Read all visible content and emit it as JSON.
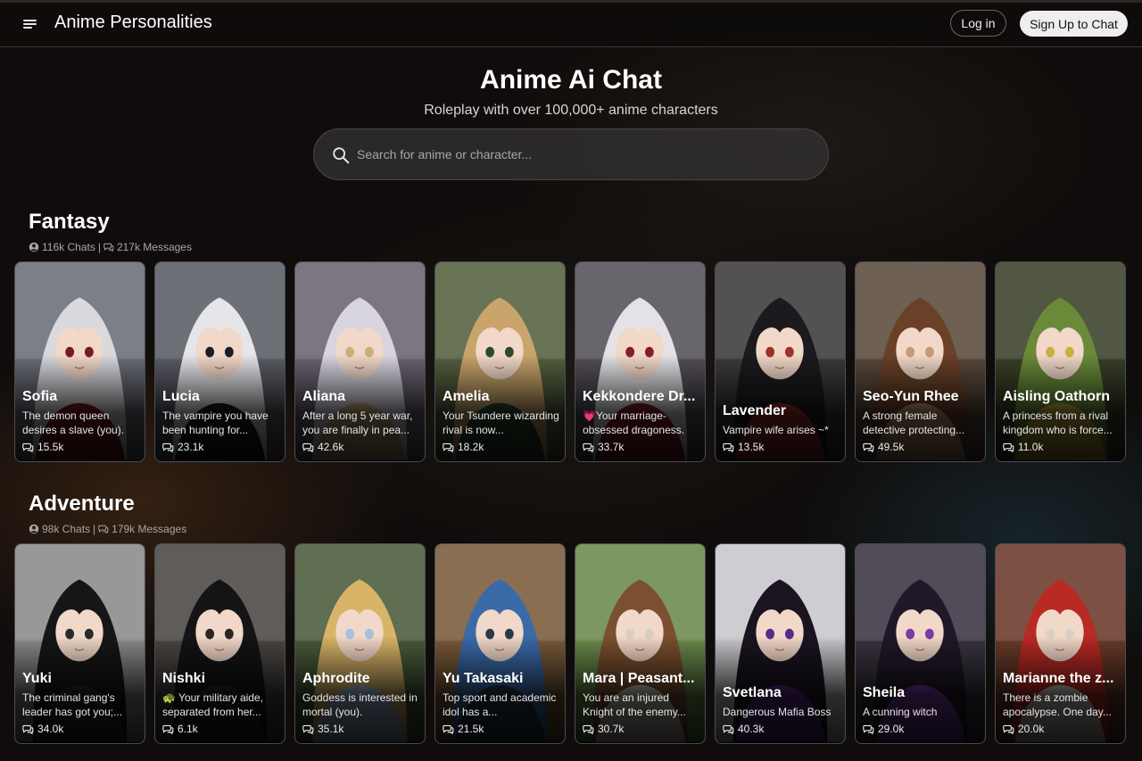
{
  "header": {
    "app_title": "Anime Personalities",
    "login_label": "Log in",
    "signup_label": "Sign Up to Chat"
  },
  "hero": {
    "title": "Anime Ai Chat",
    "subtitle": "Roleplay with over 100,000+ anime characters",
    "search_placeholder": "Search for anime or character..."
  },
  "sections": [
    {
      "title": "Fantasy",
      "chats": "116k Chats",
      "separator": "|",
      "messages": "217k Messages",
      "cards": [
        {
          "name": "Sofia",
          "desc": "The demon queen desires a slave (you).",
          "count": "15.5k",
          "hair": "#d9d9de",
          "bg": "#6b6e78",
          "accent": "#7a1a1a"
        },
        {
          "name": "Lucia",
          "desc": "The vampire you have been hunting for...",
          "count": "23.1k",
          "hair": "#e6e6ea",
          "bg": "#5b5d66",
          "accent": "#1c1c22"
        },
        {
          "name": "Aliana",
          "desc": "After a long 5 year war, you are finally in pea...",
          "count": "42.6k",
          "hair": "#d8d4e0",
          "bg": "#6a6470",
          "accent": "#c9b07a"
        },
        {
          "name": "Amelia",
          "desc": "Your Tsundere wizarding rival is now...",
          "count": "18.2k",
          "hair": "#c9a56c",
          "bg": "#55603f",
          "accent": "#2d4a2f"
        },
        {
          "name": "Kekkondere Dr...",
          "desc": "💗Your marriage-obsessed dragoness.",
          "count": "33.7k",
          "hair": "#e4e2e6",
          "bg": "#555058",
          "accent": "#8a1d22"
        },
        {
          "name": "Lavender",
          "desc": "Vampire wife arises ~*",
          "count": "13.5k",
          "hair": "#1c1a1e",
          "bg": "#3c3a3a",
          "accent": "#a0302a"
        },
        {
          "name": "Seo-Yun Rhee",
          "desc": "A strong female detective protecting...",
          "count": "49.5k",
          "hair": "#6a4128",
          "bg": "#5a4a3c",
          "accent": "#c89a76"
        },
        {
          "name": "Aisling Oathorn",
          "desc": "A princess from a rival kingdom who is force...",
          "count": "11.0k",
          "hair": "#6a8a3a",
          "bg": "#3a4028",
          "accent": "#c8b040"
        }
      ]
    },
    {
      "title": "Adventure",
      "chats": "98k Chats",
      "separator": "|",
      "messages": "179k Messages",
      "cards": [
        {
          "name": "Yuki",
          "desc": "The criminal gang's leader has got you;...",
          "count": "34.0k",
          "hair": "#161618",
          "bg": "#8a8a88",
          "accent": "#2a2a2c"
        },
        {
          "name": "Nishki",
          "desc": "🐢 Your military aide, separated from her...",
          "count": "6.1k",
          "hair": "#141416",
          "bg": "#4a4642",
          "accent": "#2a2624"
        },
        {
          "name": "Aphrodite",
          "desc": "Goddess is interested in mortal (you).",
          "count": "35.1k",
          "hair": "#d8b468",
          "bg": "#4a5a3a",
          "accent": "#a8c0e0"
        },
        {
          "name": "Yu Takasaki",
          "desc": "Top sport and academic idol has a...",
          "count": "21.5k",
          "hair": "#3a6aa8",
          "bg": "#7a5a3a",
          "accent": "#2a3a4a"
        },
        {
          "name": "Mara | Peasant...",
          "desc": "You are an injured Knight of the enemy...",
          "count": "30.7k",
          "hair": "#7a5030",
          "bg": "#6a8a4a",
          "accent": "#d8cfc0"
        },
        {
          "name": "Svetlana",
          "desc": "Dangerous Mafia Boss",
          "count": "40.3k",
          "hair": "#1a1420",
          "bg": "#c8c8cc",
          "accent": "#5a2a8a"
        },
        {
          "name": "Sheila",
          "desc": "A cunning witch",
          "count": "29.0k",
          "hair": "#201828",
          "bg": "#3a3440",
          "accent": "#7a3aa8"
        },
        {
          "name": "Marianne the z...",
          "desc": "There is a zombie apocalypse. One day...",
          "count": "20.0k",
          "hair": "#b82a24",
          "bg": "#6a3a2a",
          "accent": "#d8d0c8"
        }
      ]
    }
  ]
}
